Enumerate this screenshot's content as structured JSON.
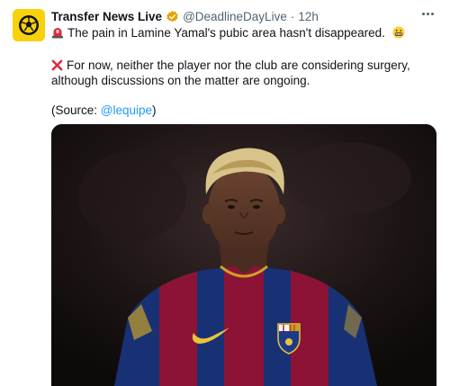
{
  "account": {
    "name": "Transfer News Live",
    "handle": "@DeadlineDayLive",
    "separator": "·",
    "time": "12h",
    "avatar_icon": "football-in-circle-logo",
    "badge_icon": "verified-badge-icon",
    "avatar_color": "#f7d20a",
    "badge_color": "#e8a400"
  },
  "tweet": {
    "line1_icon": "rotating-light-icon",
    "line1_text": "The pain in Lamine Yamal's pubic area hasn't disappeared.",
    "line1_end_icon": "grimacing-face-icon",
    "line2_icon": "cross-mark-icon",
    "line2_text": "For now, neither the player nor the club are considering surgery,",
    "line3_text": "although discussions on the matter are ongoing.",
    "source_open": "(Source: ",
    "source_link": "@lequipe",
    "source_close": ")",
    "link_color": "#1d9bf0"
  },
  "media": {
    "icon": "player-photo",
    "crest_icon": "fc-barcelona-crest-icon",
    "swoosh_icon": "nike-swoosh-icon"
  },
  "more_icon": "more-options-icon"
}
